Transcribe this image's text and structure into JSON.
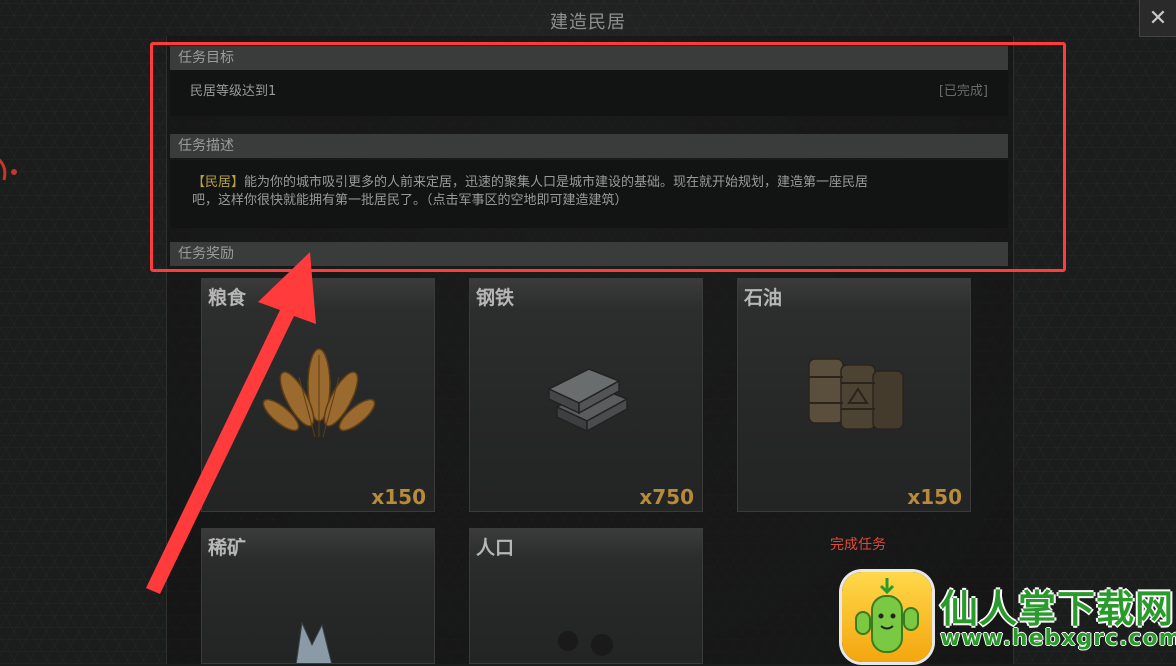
{
  "window": {
    "title": "建造民居",
    "close_label": "✕"
  },
  "task_target": {
    "header": "任务目标",
    "objective": "民居等级达到1",
    "status": "[已完成]"
  },
  "task_description": {
    "header": "任务描述",
    "highlight": "【民居】",
    "line1_rest": "能为你的城市吸引更多的人前来定居，迅速的聚集人口是城市建设的基础。现在就开始规划，建造第一座民居",
    "line2": "吧，这样你很快就能拥有第一批居民了。（点击军事区的空地即可建造建筑）"
  },
  "task_reward": {
    "header": "任务奖励",
    "items": [
      {
        "name": "粮食",
        "qty": "x150",
        "icon": "wheat-icon"
      },
      {
        "name": "钢铁",
        "qty": "x750",
        "icon": "steel-ingot-icon"
      },
      {
        "name": "石油",
        "qty": "x150",
        "icon": "oil-barrel-icon"
      },
      {
        "name": "稀矿",
        "qty": "",
        "icon": "rare-ore-icon"
      },
      {
        "name": "人口",
        "qty": "",
        "icon": "population-icon"
      }
    ]
  },
  "complete_button": {
    "label": "完成任务"
  },
  "watermark": {
    "name": "仙人掌下载网",
    "url": "www.hebxgrc.com"
  },
  "colors": {
    "highlight_box": "#ff3b3b",
    "quantity": "#b88a3c",
    "complete": "#e04a3a"
  }
}
